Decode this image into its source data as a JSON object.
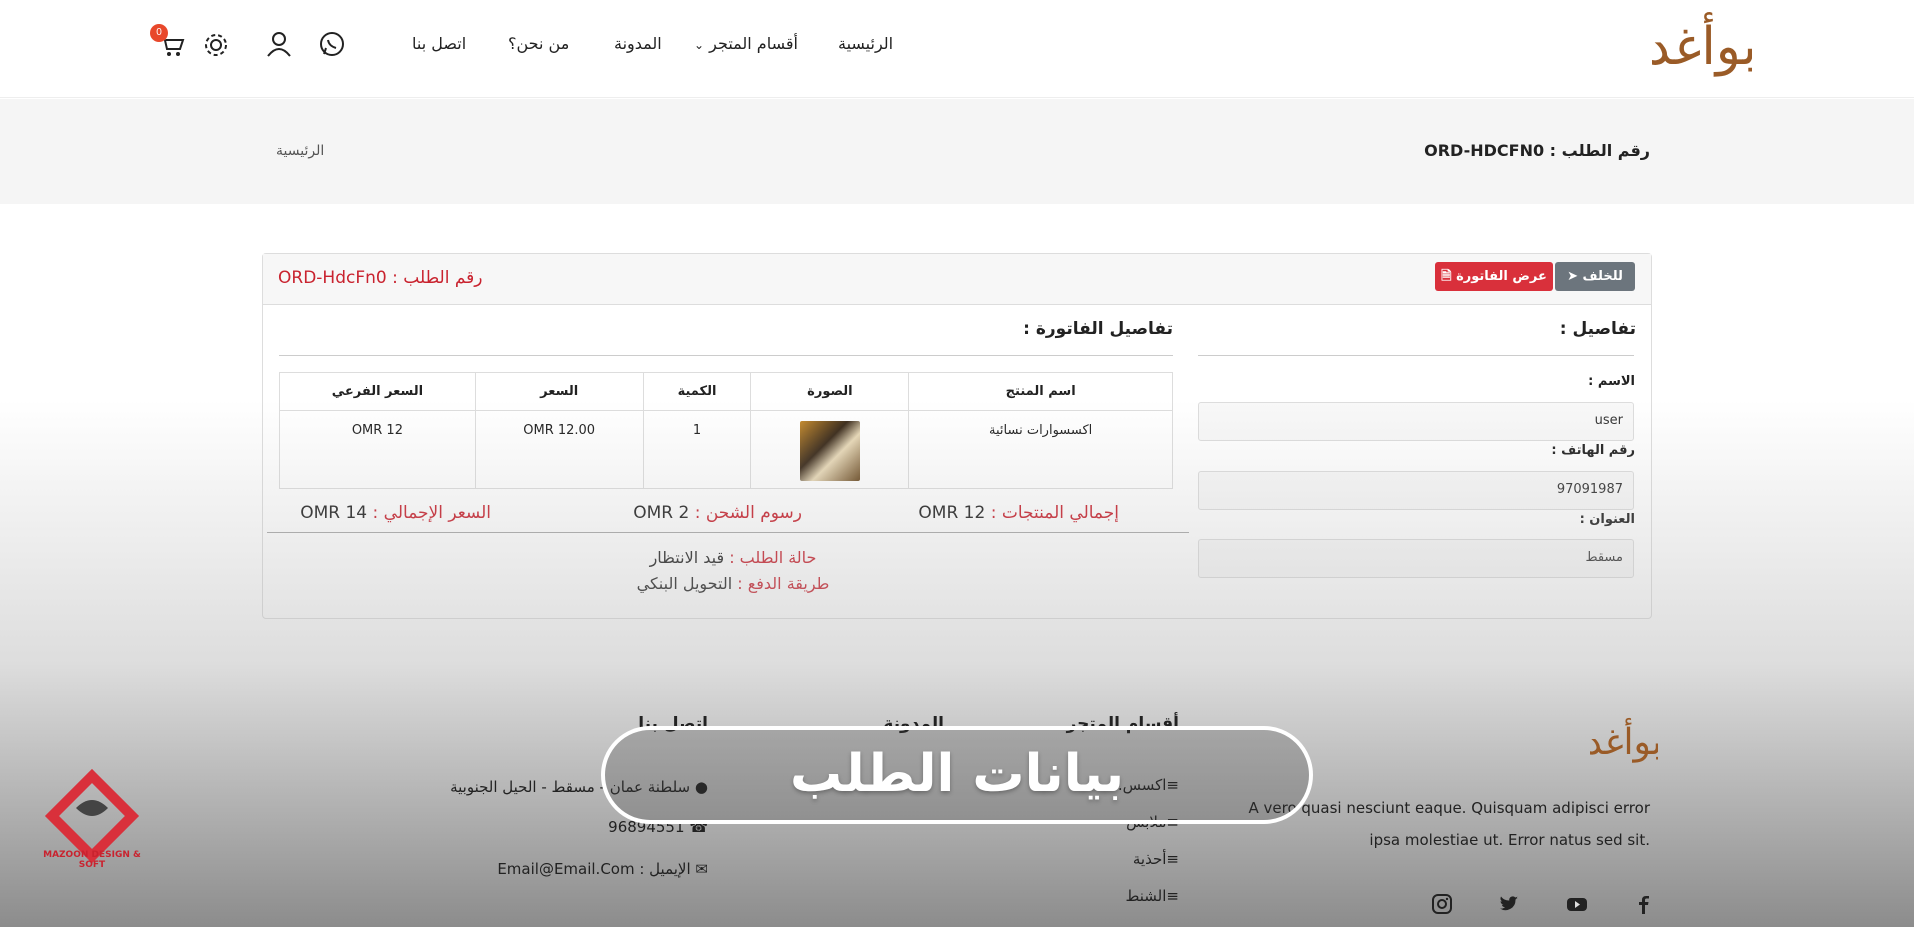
{
  "brand": {
    "logo_text": "بوأغد",
    "accent": "#c9232f",
    "logo_color": "#9a5b27"
  },
  "nav": {
    "home": "الرئيسية",
    "store": "أقسام المتجر",
    "blog": "المدونة",
    "about": "من نحن؟",
    "contact": "اتصل بنا"
  },
  "header_icons": {
    "cart_count": "0",
    "icons": [
      "cart-icon",
      "settings-icon",
      "user-icon",
      "whatsapp-icon"
    ]
  },
  "breadcrumb": {
    "title": "رقم الطلب : ORD-HDCFN0",
    "home": "الرئيسية"
  },
  "order": {
    "number_label": "رقم الطلب : ORD-HdcFn0",
    "back_label": "للخلف",
    "invoice_label": "عرض الفاتورة",
    "details_title": "تفاصيل :",
    "invoice_title": "تفاصيل الفاتورة :",
    "name_label": "الاسم :",
    "name_value": "user",
    "phone_label": "رقم الهاتف :",
    "phone_value": "97091987",
    "address_label": "العنوان :",
    "address_value": "مسقط"
  },
  "table": {
    "headers": [
      "اسم المنتج",
      "الصورة",
      "الكمية",
      "السعر",
      "السعر الفرعي"
    ],
    "rows": [
      {
        "name": "اكسسوارات نسائية",
        "qty": "1",
        "price": "OMR 12.00",
        "subtotal": "OMR 12"
      }
    ]
  },
  "summary": {
    "products_label": "إجمالي المنتجات :",
    "products_value": "OMR 12",
    "shipping_label": "رسوم الشحن :",
    "shipping_value": "OMR 2",
    "total_label": "السعر الإجمالي :",
    "total_value": "OMR 14",
    "status_label": "حالة الطلب :",
    "status_value": "قيد الانتظار",
    "payment_label": "طريقة الدفع :",
    "payment_value": "التحويل البنكي"
  },
  "footer": {
    "col_store": "أقسام المتجر",
    "col_blog": "المدونة",
    "col_contact": "اتصل بنا",
    "store_items": [
      "اكسس...",
      "ملابس",
      "أحذية",
      "الشنط"
    ],
    "address": "سلطنة عمان - مسقط - الحيل الجنوبية",
    "phone": "96894551",
    "email": "الإيميل : Email@Email.Com",
    "description": "A vero quasi nesciunt eaque. Quisquam adipisci error ipsa molestiae ut. Error natus sed sit.",
    "social_icons": [
      "facebook-icon",
      "youtube-icon",
      "twitter-icon",
      "instagram-icon"
    ]
  },
  "overlay_caption": "بيانات الطلب",
  "watermark": "MAZOON DESIGN & SOFT"
}
